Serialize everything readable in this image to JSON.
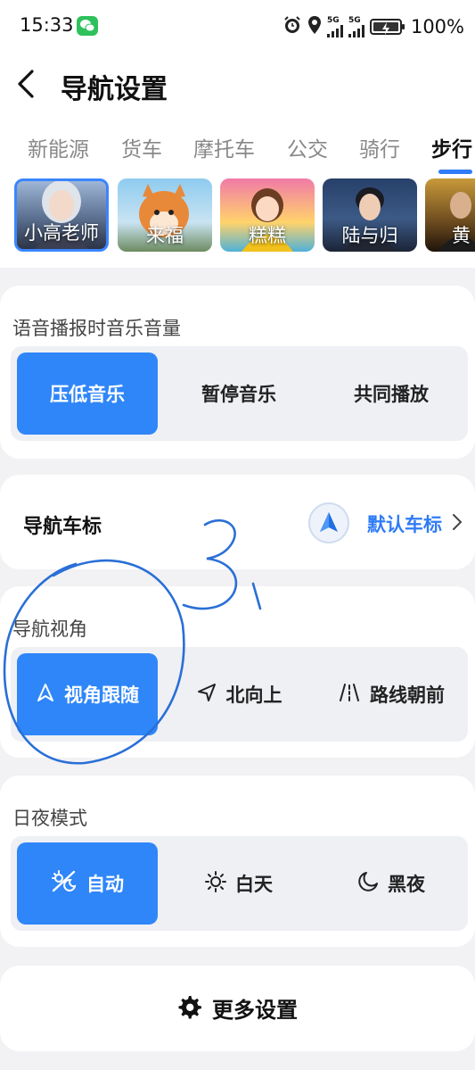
{
  "status_bar": {
    "time": "15:33",
    "net1": "5G",
    "net2": "5G",
    "battery": "100%",
    "icons": [
      "wechat-icon",
      "alarm-icon",
      "location-icon",
      "signal-icon",
      "signal-icon",
      "battery-icon"
    ]
  },
  "header": {
    "title": "导航设置",
    "back_icon": "back-arrow-icon"
  },
  "tabs": [
    {
      "label": "新能源",
      "active": false
    },
    {
      "label": "货车",
      "active": false
    },
    {
      "label": "摩托车",
      "active": false
    },
    {
      "label": "公交",
      "active": false
    },
    {
      "label": "骑行",
      "active": false
    },
    {
      "label": "步行",
      "active": true
    }
  ],
  "voices": [
    {
      "label": "小高老师",
      "selected": true
    },
    {
      "label": "来福",
      "selected": false
    },
    {
      "label": "糕糕",
      "selected": false
    },
    {
      "label": "陆与归",
      "selected": false
    },
    {
      "label": "黄",
      "selected": false
    }
  ],
  "music_volume": {
    "label": "语音播报时音乐音量",
    "options": [
      "压低音乐",
      "暂停音乐",
      "共同播放"
    ],
    "selected": "压低音乐"
  },
  "car_marker": {
    "label": "导航车标",
    "value": "默认车标"
  },
  "nav_view": {
    "label": "导航视角",
    "options": [
      "视角跟随",
      "北向上",
      "路线朝前"
    ],
    "selected": "视角跟随"
  },
  "day_night": {
    "label": "日夜模式",
    "options": [
      "自动",
      "白天",
      "黑夜"
    ],
    "selected": "自动"
  },
  "more_settings": {
    "label": "更多设置"
  },
  "annotation": {
    "text": "3,",
    "color": "#2a6fd6"
  },
  "colors": {
    "accent": "#2f86f9",
    "background": "#f2f2f4",
    "card": "#ffffff"
  }
}
